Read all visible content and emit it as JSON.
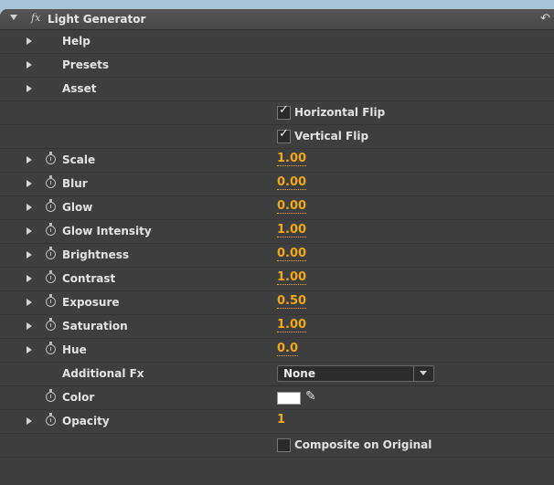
{
  "header": {
    "title": "Light Generator",
    "fx_label": "fx",
    "reset_icon": "↶"
  },
  "groups": [
    {
      "label": "Help"
    },
    {
      "label": "Presets"
    },
    {
      "label": "Asset"
    }
  ],
  "flips": {
    "horizontal": "Horizontal Flip",
    "vertical": "Vertical Flip",
    "horizontal_checked": true,
    "vertical_checked": true
  },
  "params": [
    {
      "label": "Scale",
      "value": "1.00"
    },
    {
      "label": "Blur",
      "value": "0.00"
    },
    {
      "label": "Glow",
      "value": "0.00"
    },
    {
      "label": "Glow Intensity",
      "value": "1.00"
    },
    {
      "label": "Brightness",
      "value": "0.00"
    },
    {
      "label": "Contrast",
      "value": "1.00"
    },
    {
      "label": "Exposure",
      "value": "0.50"
    },
    {
      "label": "Saturation",
      "value": "1.00"
    },
    {
      "label": "Hue",
      "value": "0.0"
    }
  ],
  "additional_fx": {
    "label": "Additional Fx",
    "selected": "None"
  },
  "color": {
    "label": "Color",
    "value": "#ffffff"
  },
  "opacity": {
    "label": "Opacity",
    "value": "1"
  },
  "composite": {
    "label": "Composite on Original",
    "checked": false
  },
  "colors": {
    "accent": "#f0a81a",
    "panel": "#3e3e3e"
  }
}
